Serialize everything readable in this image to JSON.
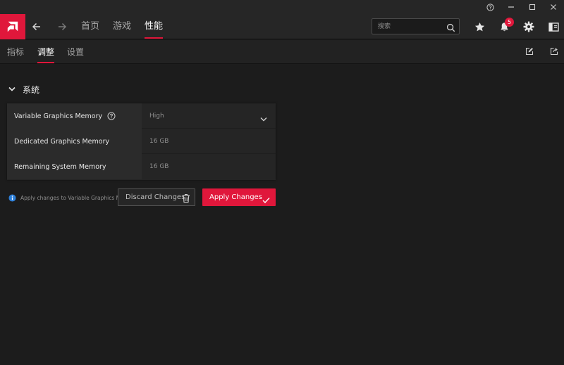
{
  "window": {
    "controls": [
      "help-icon",
      "minimize-icon",
      "maximize-icon",
      "close-icon"
    ]
  },
  "header": {
    "brand_color": "#e0173b",
    "tabs": [
      {
        "label": "首页",
        "active": false
      },
      {
        "label": "游戏",
        "active": false
      },
      {
        "label": "性能",
        "active": true
      }
    ],
    "search": {
      "placeholder": "搜索"
    },
    "notifications_count": "5",
    "icons": [
      "back-arrow-icon",
      "forward-arrow-icon",
      "search-icon",
      "star-icon",
      "bell-icon",
      "gear-icon",
      "sidebar-panel-icon"
    ]
  },
  "subnav": {
    "tabs": [
      {
        "label": "指标",
        "active": false
      },
      {
        "label": "调整",
        "active": true
      },
      {
        "label": "设置",
        "active": false
      }
    ],
    "icons": [
      "edit-icon",
      "export-icon"
    ]
  },
  "section": {
    "title": "系统",
    "rows": [
      {
        "label": "Variable Graphics Memory",
        "value": "High",
        "has_help": true,
        "dropdown": true
      },
      {
        "label": "Dedicated Graphics Memory",
        "value": "16 GB"
      },
      {
        "label": "Remaining System Memory",
        "value": "16 GB"
      }
    ]
  },
  "footer": {
    "info_text": "Apply changes to Variable Graphics Memory",
    "info_color": "#2d7fd8",
    "discard_label": "Discard Changes",
    "apply_label": "Apply Changes"
  }
}
